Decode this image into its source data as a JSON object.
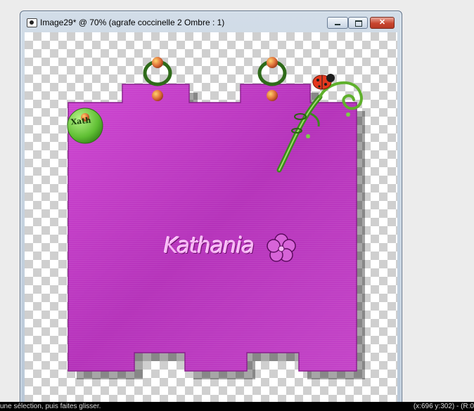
{
  "window": {
    "title": "Image29* @  70% (agrafe coccinelle 2 Ombre : 1)",
    "controls": {
      "minimize": "minimize",
      "maximize": "maximize",
      "close": "✕"
    }
  },
  "canvas": {
    "background": "transparent-checkerboard",
    "tag": {
      "fill_color": "#c23bc6",
      "edge_color": "#8a1f8e",
      "logo_text": "Kathania",
      "badge_text": "Xath",
      "badge_color": "#6fcf3f",
      "decorations": [
        "green-ring-clips",
        "orange-beads",
        "ladybug-on-stem",
        "hibiscus-flower-icon"
      ]
    }
  },
  "statusbar": {
    "hint": "une sélection, puis faites glisser.",
    "coords": "(x:696 y:302) - (R:0"
  }
}
